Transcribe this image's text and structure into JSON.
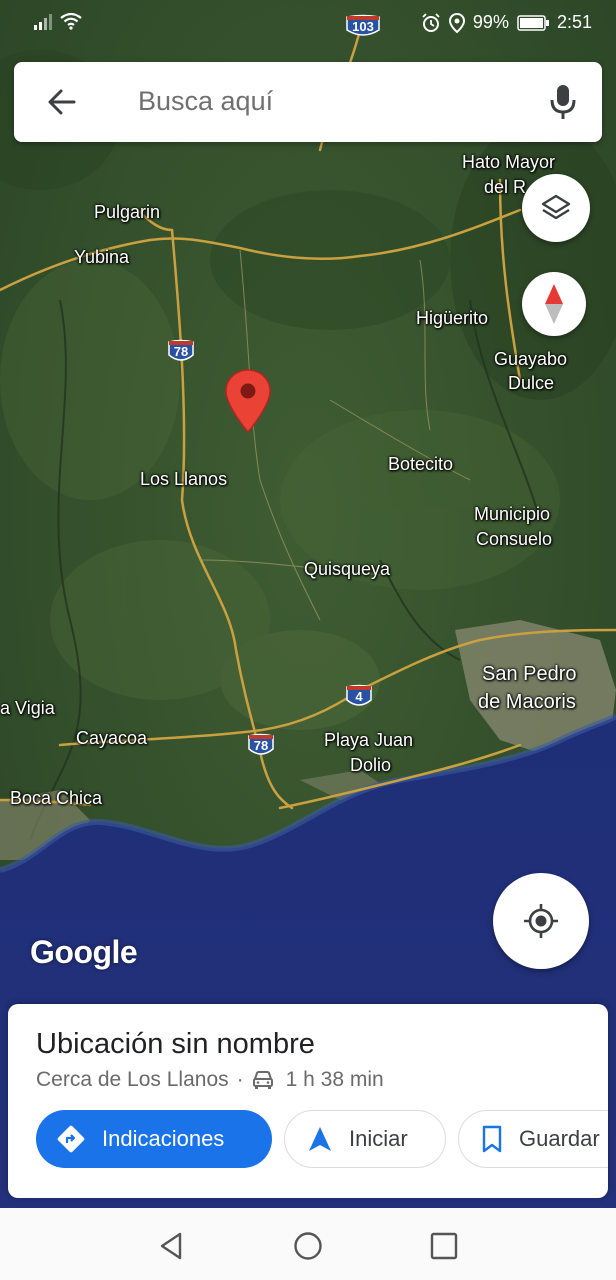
{
  "status_bar": {
    "battery": "99%",
    "time": "2:51",
    "highway_top_shield": "103"
  },
  "search": {
    "placeholder": "Busca aquí"
  },
  "map": {
    "places": {
      "hato_mayor_1": "Hato Mayor",
      "hato_mayor_2": "del R",
      "pulgarin": "Pulgarin",
      "yubina": "Yubina",
      "higuerito": "Higüerito",
      "guayabo_1": "Guayabo",
      "guayabo_2": "Dulce",
      "los_llanos": "Los Llanos",
      "botecito": "Botecito",
      "municipio_1": "Municipio",
      "municipio_2": "Consuelo",
      "quisqueya": "Quisqueya",
      "san_pedro_1": "San Pedro",
      "san_pedro_2": "de Macoris",
      "la_vigia": "a Vigia",
      "cayacoa": "Cayacoa",
      "playa_1": "Playa Juan",
      "playa_2": "Dolio",
      "boca_chica": "Boca Chica"
    },
    "shields": {
      "r78_north": "78",
      "r78_south": "78",
      "r4": "4"
    },
    "logo": "Google"
  },
  "card": {
    "title": "Ubicación sin nombre",
    "near": "Cerca de Los Llanos",
    "separator": "·",
    "duration": "1 h 38 min",
    "buttons": {
      "directions": "Indicaciones",
      "start": "Iniciar",
      "save": "Guardar"
    }
  },
  "colors": {
    "accent": "#1a73e8",
    "pin": "#ea4335"
  }
}
